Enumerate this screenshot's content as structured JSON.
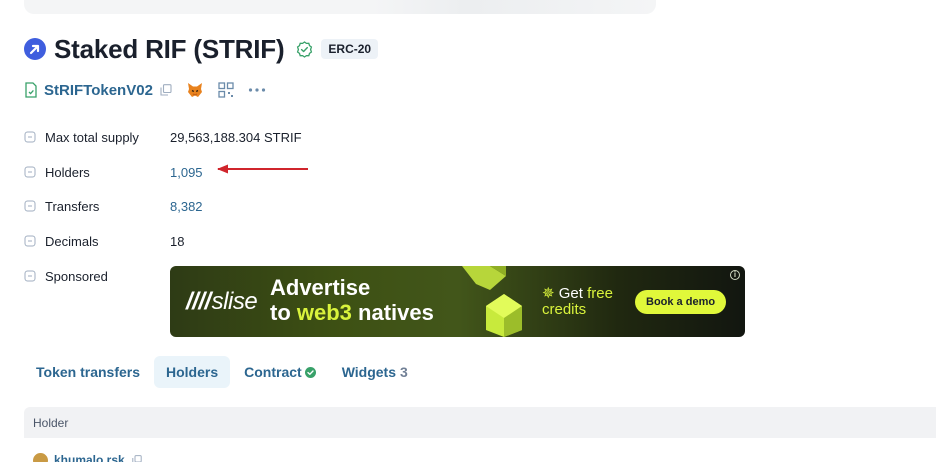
{
  "token": {
    "title": "Staked RIF (STRIF)",
    "standard_badge": "ERC-20",
    "contract_name": "StRIFTokenV02"
  },
  "details": [
    {
      "label": "Max total supply",
      "value": "29,563,188.304 STRIF",
      "is_link": false
    },
    {
      "label": "Holders",
      "value": "1,095",
      "is_link": true
    },
    {
      "label": "Transfers",
      "value": "8,382",
      "is_link": true
    },
    {
      "label": "Decimals",
      "value": "18",
      "is_link": false
    },
    {
      "label": "Sponsored",
      "value": "",
      "is_link": false
    }
  ],
  "ad": {
    "brand": "slise",
    "headline_line1": "Advertise",
    "headline_line2_prefix": "to ",
    "headline_line2_highlight": "web3",
    "headline_line2_suffix": " natives",
    "credits_prefix": "Get ",
    "credits_highlight": "free",
    "credits_line2": "credits",
    "cta": "Book a demo",
    "info_glyph": "i"
  },
  "tabs": [
    {
      "label": "Token transfers",
      "active": false
    },
    {
      "label": "Holders",
      "active": true
    },
    {
      "label": "Contract",
      "active": false,
      "verified": true
    },
    {
      "label": "Widgets",
      "active": false,
      "count": "3"
    }
  ],
  "table": {
    "column_header": "Holder",
    "rows": [
      {
        "holder": "khumalo.rsk"
      }
    ]
  },
  "icons": {
    "token_logo": "rif-logo-icon",
    "verified": "verified-check-icon",
    "contract": "document-icon",
    "copy": "copy-icon",
    "wallet": "metamask-fox-icon",
    "qr": "qr-code-icon",
    "more": "more-dots-icon",
    "annotation": "red-arrow-annotation"
  },
  "colors": {
    "link": "#2c6690",
    "accent_blue": "#3f5ede",
    "verified_green": "#38a169",
    "ad_highlight": "#d9f33c",
    "annotation_red": "#d0252c",
    "active_tab_bg": "#eaf4fa"
  }
}
